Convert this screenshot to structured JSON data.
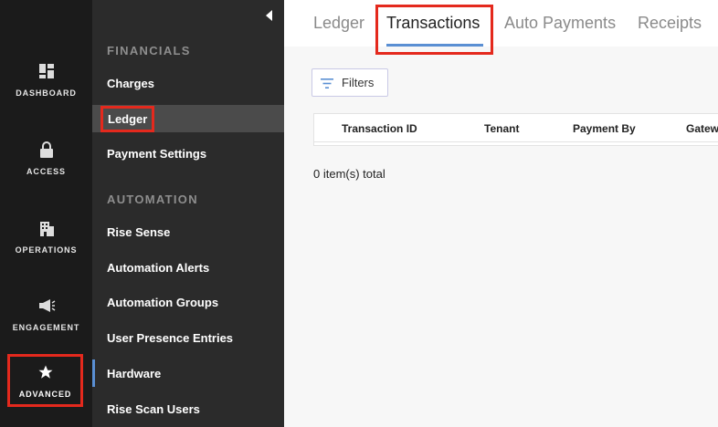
{
  "rail": {
    "items": [
      {
        "label": "DASHBOARD",
        "icon": "dashboard-icon"
      },
      {
        "label": "ACCESS",
        "icon": "lock-icon"
      },
      {
        "label": "OPERATIONS",
        "icon": "building-icon"
      },
      {
        "label": "ENGAGEMENT",
        "icon": "megaphone-icon"
      },
      {
        "label": "ADVANCED",
        "icon": "star-icon"
      }
    ],
    "active": "ADVANCED"
  },
  "submenu": {
    "sections": [
      {
        "title": "FINANCIALS",
        "items": [
          "Charges",
          "Ledger",
          "Payment Settings"
        ]
      },
      {
        "title": "AUTOMATION",
        "items": [
          "Rise Sense",
          "Automation Alerts",
          "Automation Groups",
          "User Presence Entries",
          "Hardware",
          "Rise Scan Users"
        ]
      }
    ],
    "selected": "Ledger"
  },
  "tabs": [
    "Ledger",
    "Transactions",
    "Auto Payments",
    "Receipts"
  ],
  "active_tab": "Transactions",
  "filters_label": "Filters",
  "table": {
    "columns": [
      "Transaction ID",
      "Tenant",
      "Payment By",
      "Gateway"
    ]
  },
  "total_text": "0 item(s) total",
  "colors": {
    "rail_bg": "#1b1b1b",
    "submenu_bg": "#2b2b2b",
    "highlight": "#e4291d",
    "accent": "#5a8fd3"
  }
}
